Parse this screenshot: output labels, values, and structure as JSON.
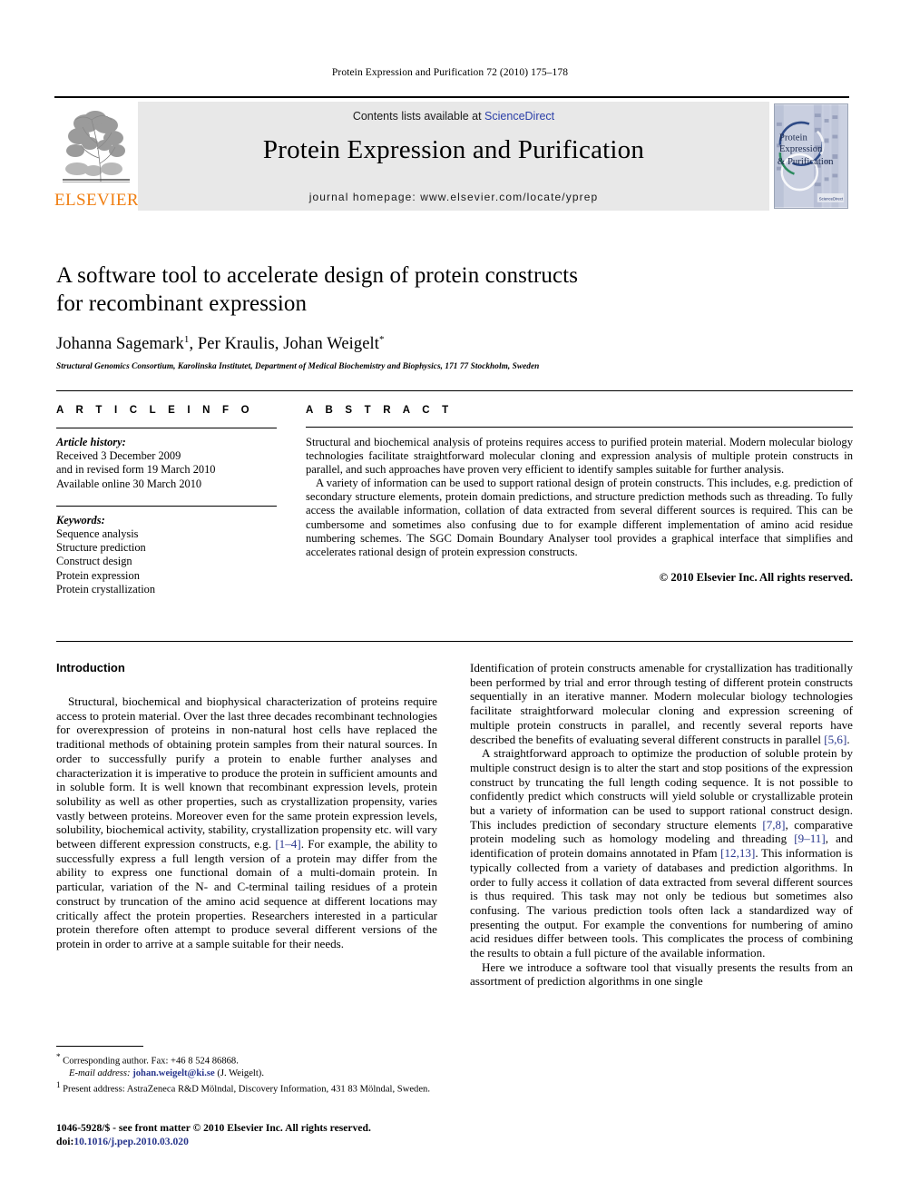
{
  "running_head": "Protein Expression and Purification 72 (2010) 175–178",
  "masthead": {
    "publisher_logo_label": "ELSEVIER",
    "contents_prefix": "Contents lists available at ",
    "sciencedirect": "ScienceDirect",
    "journal_title": "Protein Expression and Purification",
    "homepage": "journal homepage: www.elsevier.com/locate/yprep",
    "cover_title_line1": "Protein",
    "cover_title_line2": "Expression",
    "cover_title_line3": "& Purification",
    "cover_badge": "ScienceDirect",
    "colors": {
      "band_background": "#e8e8e8",
      "elsevier_orange": "#f07f13",
      "link_blue": "#2b3fa8",
      "reference_blue": "#27358c"
    }
  },
  "article": {
    "title_line1": "A software tool to accelerate design of protein constructs",
    "title_line2": "for recombinant expression",
    "authors": "Johanna Sagemark , Per Kraulis, Johan Weigelt",
    "author_marks": {
      "sagemark": "1",
      "weigelt": "*"
    },
    "affiliation": "Structural Genomics Consortium, Karolinska Institutet, Department of Medical Biochemistry and Biophysics, 171 77 Stockholm, Sweden"
  },
  "article_info": {
    "heading": "A R T I C L E   I N F O",
    "history_label": "Article history:",
    "history_lines": [
      "Received 3 December 2009",
      "and in revised form 19 March 2010",
      "Available online 30 March 2010"
    ],
    "keywords_label": "Keywords:",
    "keywords": [
      "Sequence analysis",
      "Structure prediction",
      "Construct design",
      "Protein expression",
      "Protein crystallization"
    ]
  },
  "abstract": {
    "heading": "A B S T R A C T",
    "paragraph1": "Structural and biochemical analysis of proteins requires access to purified protein material. Modern molecular biology technologies facilitate straightforward molecular cloning and expression analysis of multiple protein constructs in parallel, and such approaches have proven very efficient to identify samples suitable for further analysis.",
    "paragraph2": "A variety of information can be used to support rational design of protein constructs. This includes, e.g. prediction of secondary structure elements, protein domain predictions, and structure prediction methods such as threading. To fully access the available information, collation of data extracted from several different sources is required. This can be cumbersome and sometimes also confusing due to for example different implementation of amino acid residue numbering schemes. The SGC Domain Boundary Analyser tool provides a graphical interface that simplifies and accelerates rational design of protein expression constructs.",
    "copyright": "© 2010 Elsevier Inc. All rights reserved."
  },
  "body": {
    "intro_heading": "Introduction",
    "left_p1_a": "Structural, biochemical and biophysical characterization of proteins require access to protein material. Over the last three decades recombinant technologies for overexpression of proteins in non-natural host cells have replaced the traditional methods of obtaining protein samples from their natural sources. In order to successfully purify a protein to enable further analyses and characterization it is imperative to produce the protein in sufficient amounts and in soluble form. It is well known that recombinant expression levels, protein solubility as well as other properties, such as crystallization propensity, varies vastly between proteins. Moreover even for the same protein expression levels, solubility, biochemical activity, stability, crystallization propensity etc. will vary between different expression constructs, e.g. ",
    "left_p1_ref": "[1–4]",
    "left_p1_b": ". For example, the ability to successfully express a full length version of a protein may differ from the ability to express one functional domain of a multi-domain protein. In particular, variation of the N- and C-terminal tailing residues of a protein construct by truncation of the amino acid sequence at different locations may critically affect the protein properties. Researchers interested in a particular protein therefore often attempt to produce several different versions of the protein in order to arrive at a sample suitable for their needs.",
    "right_p1_a": "Identification of protein constructs amenable for crystallization has traditionally been performed by trial and error through testing of different protein constructs sequentially in an iterative manner. Modern molecular biology technologies facilitate straightforward molecular cloning and expression screening of multiple protein constructs in parallel, and recently several reports have described the benefits of evaluating several different constructs in parallel ",
    "right_p1_ref": "[5,6]",
    "right_p1_b": ".",
    "right_p2_a": "A straightforward approach to optimize the production of soluble protein by multiple construct design is to alter the start and stop positions of the expression construct by truncating the full length coding sequence. It is not possible to confidently predict which constructs will yield soluble or crystallizable protein but a variety of information can be used to support rational construct design. This includes prediction of secondary structure elements ",
    "right_p2_ref1": "[7,8]",
    "right_p2_b": ", comparative protein modeling such as homology modeling and threading ",
    "right_p2_ref2": "[9–11]",
    "right_p2_c": ", and identification of protein domains annotated in Pfam ",
    "right_p2_ref3": "[12,13]",
    "right_p2_d": ". This information is typically collected from a variety of databases and prediction algorithms. In order to fully access it collation of data extracted from several different sources is thus required. This task may not only be tedious but sometimes also confusing. The various prediction tools often lack a standardized way of presenting the output. For example the conventions for numbering of amino acid residues differ between tools. This complicates the process of combining the results to obtain a full picture of the available information.",
    "right_p3": "Here we introduce a software tool that visually presents the results from an assortment of prediction algorithms in one single"
  },
  "footnotes": {
    "corresponding_mark": "*",
    "corresponding_text": "Corresponding author. Fax: +46 8 524 86868.",
    "email_label": "E-mail address:",
    "email_value": "johan.weigelt@ki.se",
    "email_suffix": "(J. Weigelt).",
    "present_mark": "1",
    "present_text": "Present address: AstraZeneca R&D Mölndal, Discovery Information, 431 83 Mölndal, Sweden."
  },
  "imprint": {
    "line1": "1046-5928/$ - see front matter © 2010 Elsevier Inc. All rights reserved.",
    "doi_label": "doi:",
    "doi_value": "10.1016/j.pep.2010.03.020"
  }
}
